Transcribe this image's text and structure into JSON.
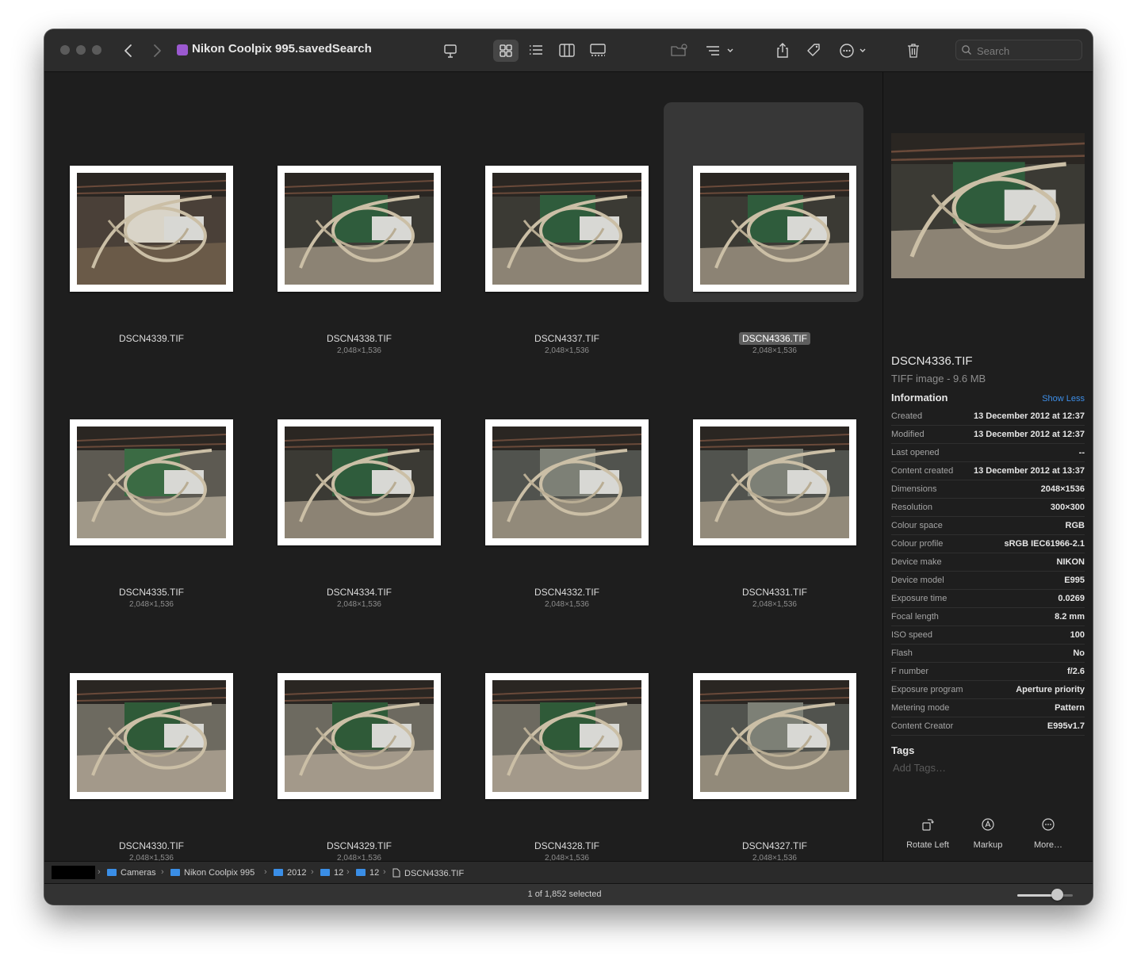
{
  "window": {
    "title": "Nikon Coolpix 995.savedSearch"
  },
  "toolbar": {
    "search_placeholder": "Search"
  },
  "colors": {
    "accent": "#3d8ee8",
    "selection": "#373737",
    "folder": "#3a8ee6"
  },
  "grid": {
    "selected_index": 3,
    "items": [
      {
        "name": "DSCN4339.TIF",
        "dims": "",
        "scene": "a"
      },
      {
        "name": "DSCN4338.TIF",
        "dims": "2,048×1,536",
        "scene": "b"
      },
      {
        "name": "DSCN4337.TIF",
        "dims": "2,048×1,536",
        "scene": "b"
      },
      {
        "name": "DSCN4336.TIF",
        "dims": "2,048×1,536",
        "scene": "b"
      },
      {
        "name": "DSCN4335.TIF",
        "dims": "2,048×1,536",
        "scene": "c"
      },
      {
        "name": "DSCN4334.TIF",
        "dims": "2,048×1,536",
        "scene": "b"
      },
      {
        "name": "DSCN4332.TIF",
        "dims": "2,048×1,536",
        "scene": "d"
      },
      {
        "name": "DSCN4331.TIF",
        "dims": "2,048×1,536",
        "scene": "d"
      },
      {
        "name": "DSCN4330.TIF",
        "dims": "2,048×1,536",
        "scene": "e"
      },
      {
        "name": "DSCN4329.TIF",
        "dims": "2,048×1,536",
        "scene": "e"
      },
      {
        "name": "DSCN4328.TIF",
        "dims": "2,048×1,536",
        "scene": "e"
      },
      {
        "name": "DSCN4327.TIF",
        "dims": "2,048×1,536",
        "scene": "d"
      }
    ]
  },
  "preview": {
    "name": "DSCN4336.TIF",
    "kind": "TIFF image - 9.6 MB",
    "info_heading": "Information",
    "show_less": "Show Less",
    "rows": [
      {
        "k": "Created",
        "v": "13 December 2012 at 12:37"
      },
      {
        "k": "Modified",
        "v": "13 December 2012 at 12:37"
      },
      {
        "k": "Last opened",
        "v": "--"
      },
      {
        "k": "Content created",
        "v": "13 December 2012 at 13:37"
      },
      {
        "k": "Dimensions",
        "v": "2048×1536"
      },
      {
        "k": "Resolution",
        "v": "300×300"
      },
      {
        "k": "Colour space",
        "v": "RGB"
      },
      {
        "k": "Colour profile",
        "v": "sRGB IEC61966-2.1"
      },
      {
        "k": "Device make",
        "v": "NIKON"
      },
      {
        "k": "Device model",
        "v": "E995"
      },
      {
        "k": "Exposure time",
        "v": "0.0269"
      },
      {
        "k": "Focal length",
        "v": "8.2 mm"
      },
      {
        "k": "ISO speed",
        "v": "100"
      },
      {
        "k": "Flash",
        "v": "No"
      },
      {
        "k": "F number",
        "v": "f/2.6"
      },
      {
        "k": "Exposure program",
        "v": "Aperture priority"
      },
      {
        "k": "Metering mode",
        "v": "Pattern"
      },
      {
        "k": "Content Creator",
        "v": "E995v1.7"
      }
    ],
    "tags_heading": "Tags",
    "tags_placeholder": "Add Tags…",
    "actions": {
      "rotate": "Rotate Left",
      "markup": "Markup",
      "more": "More…"
    }
  },
  "pathbar": {
    "crumbs": [
      "Cameras",
      "Nikon Coolpix 995",
      "2012",
      "12",
      "12",
      "DSCN4336.TIF"
    ]
  },
  "status": {
    "text": "1 of 1,852 selected",
    "zoom_level": 0.72
  }
}
